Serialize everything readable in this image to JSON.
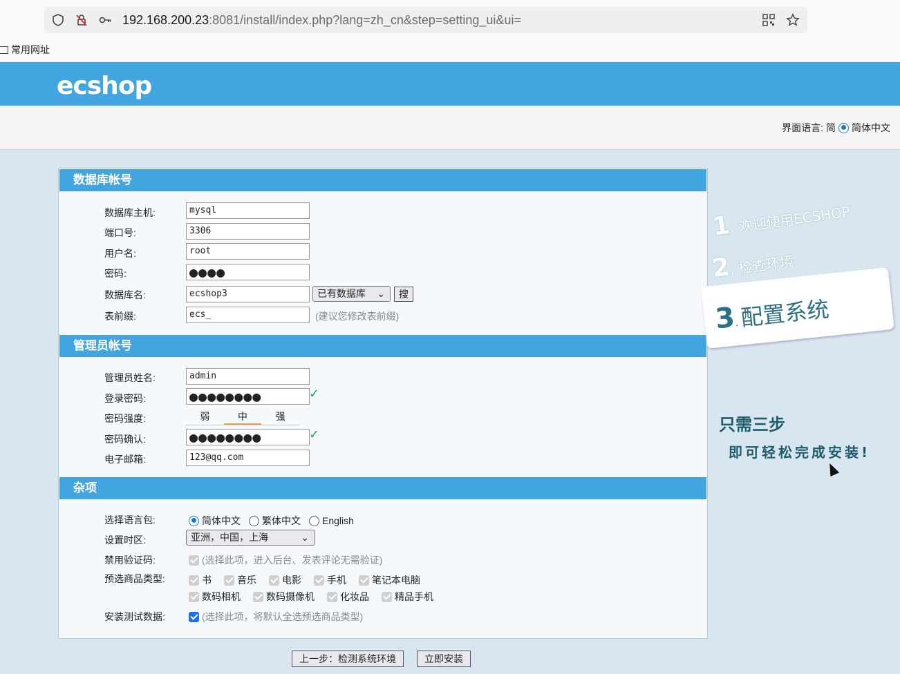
{
  "browser": {
    "url_host": "192.168.200.23",
    "url_rest": ":8081/install/index.php?lang=zh_cn&step=setting_ui&ui=",
    "bookmark": "常用网址",
    "icons": [
      "shield-icon",
      "blocked-lock-icon",
      "key-icon",
      "qr-code-icon",
      "star-icon"
    ]
  },
  "header": {
    "logo": "ecshop",
    "lang_label": "界面语言:",
    "lang_short": "简",
    "lang_option": "简体中文"
  },
  "db": {
    "title": "数据库帐号",
    "host_label": "数据库主机:",
    "host": "mysql",
    "port_label": "端口号:",
    "port": "3306",
    "user_label": "用户名:",
    "user": "root",
    "pass_label": "密码:",
    "pass_mask": "●●●●",
    "name_label": "数据库名:",
    "name": "ecshop3",
    "existing_db": "已有数据库",
    "search_btn": "搜",
    "prefix_label": "表前缀:",
    "prefix": "ecs_",
    "prefix_hint": "(建议您修改表前缀)"
  },
  "admin": {
    "title": "管理员帐号",
    "name_label": "管理员姓名:",
    "name": "admin",
    "pass_label": "登录密码:",
    "pass_mask": "●●●●●●●●",
    "strength_label": "密码强度:",
    "strength": [
      "弱",
      "中",
      "强"
    ],
    "confirm_label": "密码确认:",
    "confirm_mask": "●●●●●●●●",
    "email_label": "电子邮箱:",
    "email": "123@qq.com",
    "check": "✓"
  },
  "misc": {
    "title": "杂项",
    "langpack_label": "选择语言包:",
    "langpacks": [
      "简体中文",
      "繁体中文",
      "English"
    ],
    "timezone_label": "设置时区:",
    "timezone": "亚洲，中国，上海",
    "captcha_label": "禁用验证码:",
    "captcha_hint": "(选择此项，进入后台、发表评论无需验证)",
    "goods_label": "预选商品类型:",
    "goods_row1": [
      "书",
      "音乐",
      "电影",
      "手机",
      "笔记本电脑"
    ],
    "goods_row2": [
      "数码相机",
      "数码摄像机",
      "化妆品",
      "精品手机"
    ],
    "testdata_label": "安装测试数据:",
    "testdata_hint": "(选择此项，将默认全选预选商品类型)"
  },
  "steps": {
    "s1": "欢迎使用ECSHOP",
    "s2": "检查环境",
    "s3": "配置系统",
    "slogan1": "只需三步",
    "slogan2": "即可轻松完成安装!"
  },
  "footer": {
    "prev": "上一步：检测系统环境",
    "install": "立即安装"
  }
}
